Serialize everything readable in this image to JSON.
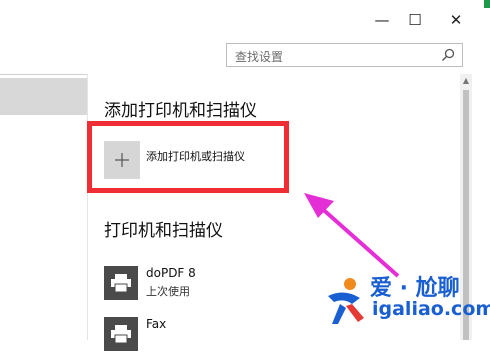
{
  "window": {
    "minimize_glyph": "—",
    "maximize_glyph": "☐",
    "close_glyph": "✕"
  },
  "search": {
    "placeholder": "查找设置",
    "icon": "search-icon"
  },
  "add_section": {
    "title": "添加打印机和扫描仪",
    "add_button_label": "添加打印机或扫描仪",
    "add_icon": "plus-icon"
  },
  "devices_section": {
    "title": "打印机和扫描仪",
    "devices": [
      {
        "name": "doPDF 8",
        "status": "上次使用",
        "icon": "printer-icon"
      },
      {
        "name": "Fax",
        "status": "",
        "icon": "printer-icon"
      }
    ]
  },
  "annotation": {
    "highlight_color": "#ef2d35",
    "arrow_color": "#e52fd6"
  },
  "watermark": {
    "text_cn": "爱 · 尬聊",
    "url": "igaliao.com",
    "color": "#1a5fd1"
  }
}
